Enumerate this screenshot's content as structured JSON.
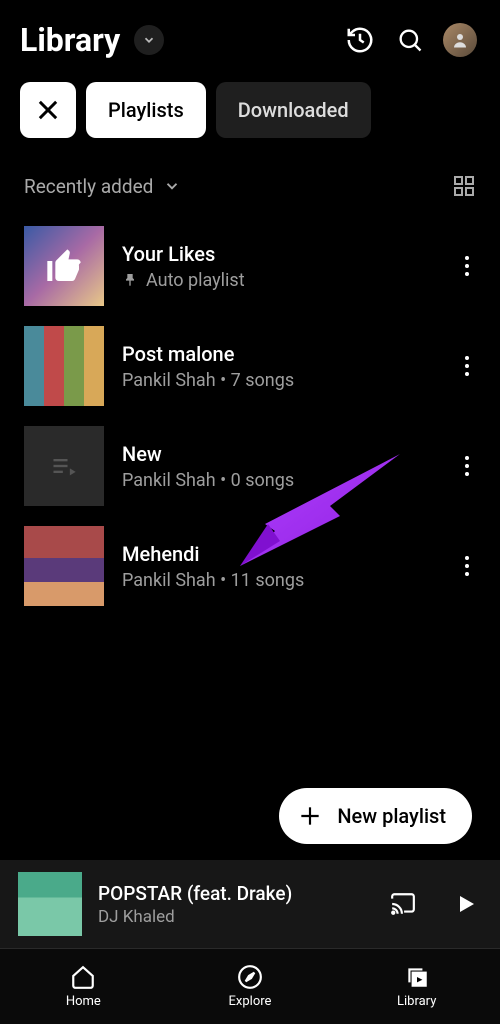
{
  "header": {
    "title": "Library"
  },
  "filters": {
    "active": "Playlists",
    "other": "Downloaded"
  },
  "sort": {
    "label": "Recently added"
  },
  "playlists": [
    {
      "title": "Your Likes",
      "subtitle": "Auto playlist",
      "pinned": true,
      "thumb": "likes"
    },
    {
      "title": "Post malone",
      "subtitle": "Pankil Shah • 7 songs",
      "pinned": false,
      "thumb": "collage1"
    },
    {
      "title": "New",
      "subtitle": "Pankil Shah • 0 songs",
      "pinned": false,
      "thumb": "empty"
    },
    {
      "title": "Mehendi",
      "subtitle": "Pankil Shah • 11 songs",
      "pinned": false,
      "thumb": "collage2"
    }
  ],
  "fab": {
    "label": "New playlist"
  },
  "miniplayer": {
    "title": "POPSTAR (feat. Drake)",
    "artist": "DJ Khaled"
  },
  "nav": {
    "home": "Home",
    "explore": "Explore",
    "library": "Library"
  }
}
